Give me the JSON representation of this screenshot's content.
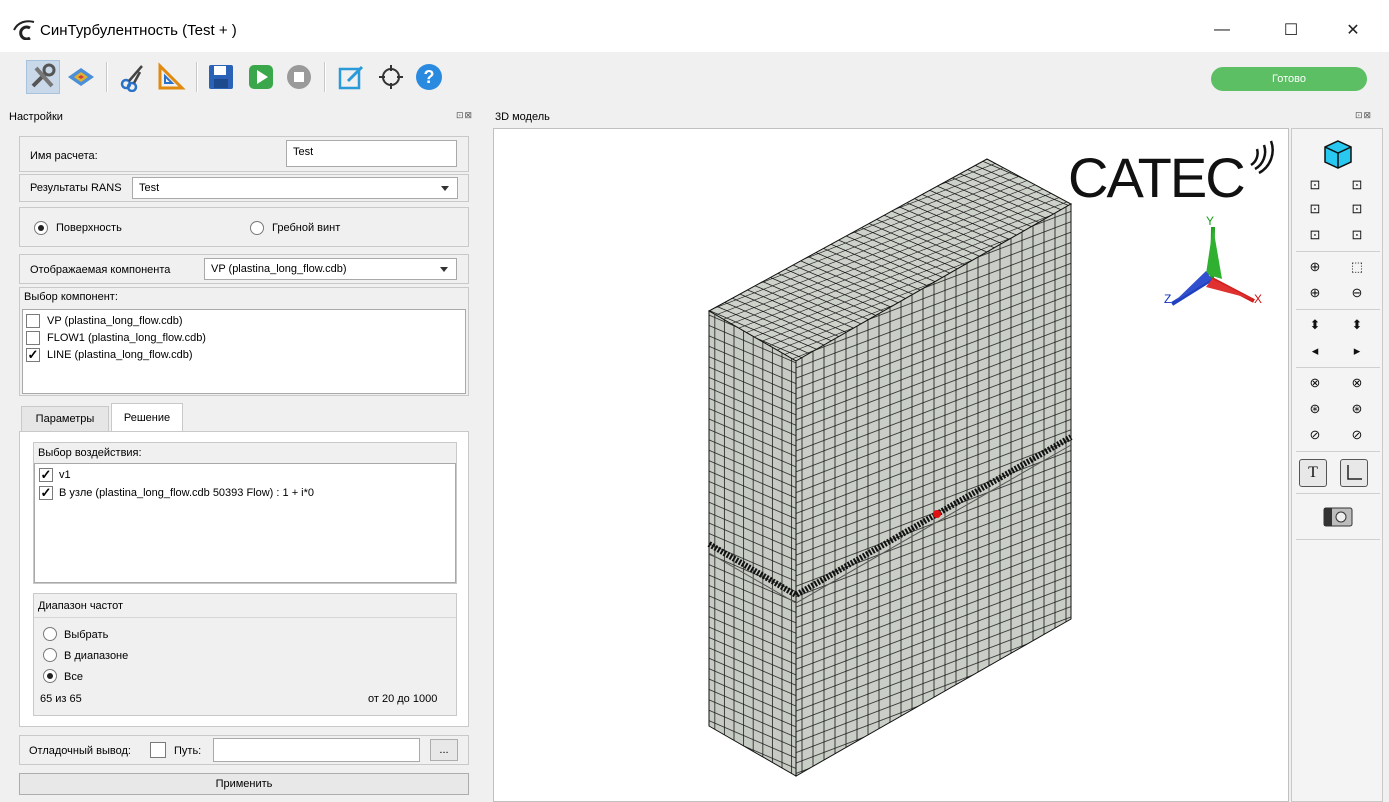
{
  "window": {
    "title": "СинТурбулентность (Test + )",
    "minimize": "—",
    "maximize": "☐",
    "close": "✕"
  },
  "toolbar": {
    "icons": [
      "settings-tools-icon",
      "mesh-surface-icon",
      "scissors-icon",
      "triangle-ruler-icon",
      "save-icon",
      "run-icon",
      "stop-icon",
      "edit-icon",
      "fit-view-icon",
      "help-icon"
    ],
    "status": "Готово",
    "status_color": "#5cbf64"
  },
  "settings_panel": {
    "title": "Настройки",
    "dock_controls": "⊡⊠",
    "calc_name_label": "Имя расчета:",
    "calc_name_value": "Test",
    "rans_label": "Результаты RANS",
    "rans_value": "Test",
    "mode_surface": "Поверхность",
    "mode_propeller": "Гребной винт",
    "component_label": "Отображаемая компонента",
    "component_value": "VP (plastina_long_flow.cdb)",
    "components_title": "Выбор компонент:",
    "components": [
      {
        "label": "VP (plastina_long_flow.cdb)",
        "checked": false
      },
      {
        "label": "FLOW1 (plastina_long_flow.cdb)",
        "checked": false
      },
      {
        "label": "LINE (plastina_long_flow.cdb)",
        "checked": true
      }
    ],
    "tabs": [
      "Параметры",
      "Решение"
    ],
    "actions_title": "Выбор воздействия:",
    "actions": [
      {
        "label": "v1",
        "checked": true
      },
      {
        "label": "В узле (plastina_long_flow.cdb 50393 Flow) : 1 + i*0",
        "checked": true
      }
    ],
    "freq_title": "Диапазон частот",
    "freq_options": [
      "Выбрать",
      "В диапазоне",
      "Все"
    ],
    "freq_count": "65 из 65",
    "freq_range": "от 20 до 1000",
    "debug_label": "Отладочный вывод:",
    "path_label": "Путь:",
    "browse_label": "...",
    "apply_label": "Применить",
    "check_mark": "✓"
  },
  "model_panel": {
    "title": "3D модель",
    "dock_controls": "⊡⊠",
    "logo_text": "CATEC",
    "axis_x": "X",
    "axis_y": "Y",
    "axis_z": "Z"
  },
  "view_tools": {
    "icons": [
      "view-cube-icon",
      "view-front-icon",
      "view-back-icon",
      "view-left-icon",
      "view-right-icon",
      "view-top-icon",
      "view-bottom-icon",
      "zoom-window-icon",
      "zoom-region-icon",
      "zoom-in-icon",
      "zoom-out-icon",
      "pan-up-icon",
      "pan-down-icon",
      "pan-left-icon",
      "pan-right-icon",
      "rotate-x-ccw-icon",
      "rotate-x-cw-icon",
      "rotate-y-ccw-icon",
      "rotate-y-cw-icon",
      "rotate-z-ccw-icon",
      "rotate-z-cw-icon",
      "text-toggle-icon",
      "axes-toggle-icon",
      "camera-icon"
    ],
    "text_toggle": "T"
  }
}
